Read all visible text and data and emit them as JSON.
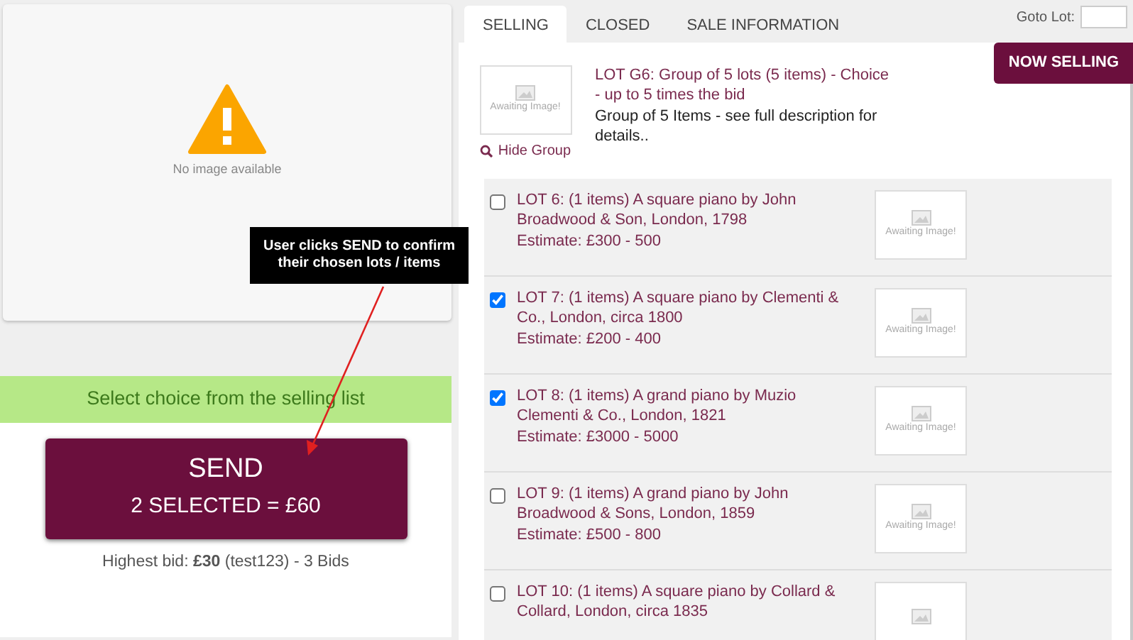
{
  "main_image": {
    "caption": "No image available"
  },
  "annotation": {
    "text": "User clicks SEND to confirm their chosen lots / items"
  },
  "banner": "Select choice from the selling list",
  "send_button": {
    "title": "SEND",
    "subtitle": "2 SELECTED = £60"
  },
  "highest_bid": "Highest bid: **£30** (test123) - 3 Bids",
  "tabs": [
    {
      "label": "SELLING",
      "selected": true
    },
    {
      "label": "CLOSED",
      "selected": false
    },
    {
      "label": "SALE INFORMATION",
      "selected": false
    }
  ],
  "goto_lot": {
    "label": "Goto Lot:"
  },
  "now_selling": "NOW SELLING",
  "group": {
    "image_text": "Awaiting Image!",
    "hide_link": "Hide Group",
    "lot": "LOT G6:",
    "title": "Group of 5 lots (5 items) - Choice - up to 5 times the bid",
    "description": "Group of 5 Items - see full description for details.."
  },
  "lots": [
    {
      "lot": "LOT 6:",
      "title": "(1 items) A square piano by John Broadwood & Son, London, 1798",
      "estimate": "Estimate: £300 - 500",
      "checked": false,
      "image_text": "Awaiting Image!"
    },
    {
      "lot": "LOT 7:",
      "title": "(1 items) A square piano by Clementi & Co., London, circa 1800",
      "estimate": "Estimate: £200 - 400",
      "checked": true,
      "image_text": "Awaiting Image!"
    },
    {
      "lot": "LOT 8:",
      "title": "(1 items) A grand piano by Muzio Clementi & Co., London, 1821",
      "estimate": "Estimate: £3000 - 5000",
      "checked": true,
      "image_text": "Awaiting Image!"
    },
    {
      "lot": "LOT 9:",
      "title": "(1 items) A grand piano by John Broadwood & Sons, London, 1859",
      "estimate": "Estimate: £500 - 800",
      "checked": false,
      "image_text": "Awaiting Image!"
    },
    {
      "lot": "LOT 10:",
      "title": "(1 items) A square piano by Collard & Collard, London, circa 1835",
      "checked": false
    }
  ]
}
